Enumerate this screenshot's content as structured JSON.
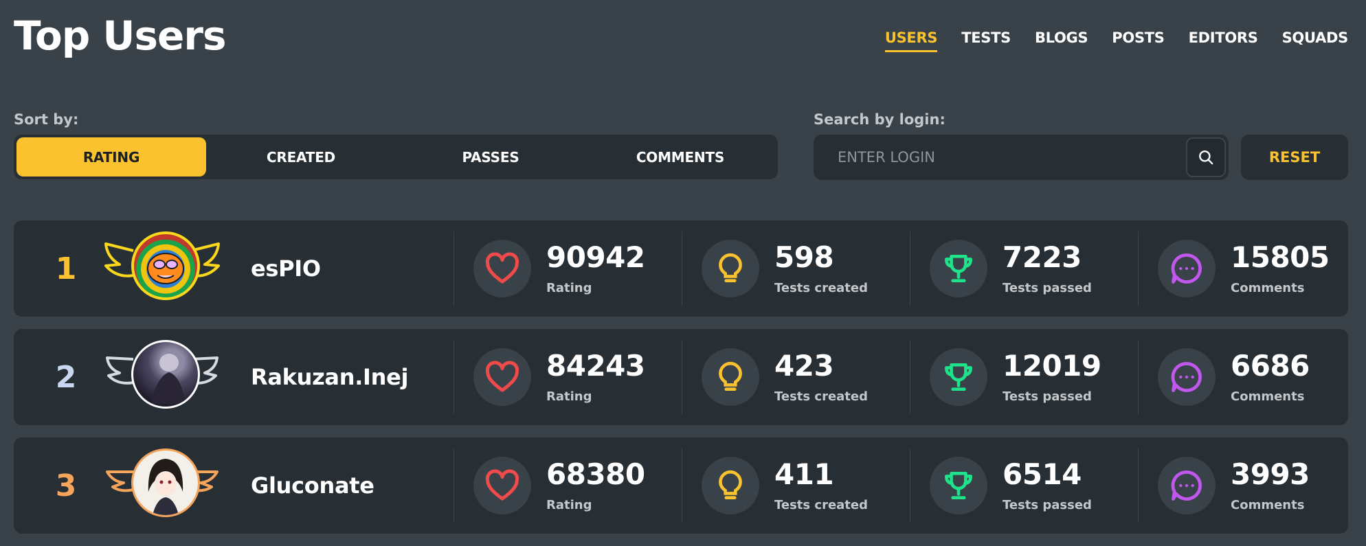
{
  "header": {
    "title": "Top Users",
    "nav": [
      {
        "label": "USERS",
        "active": true
      },
      {
        "label": "TESTS"
      },
      {
        "label": "BLOGS"
      },
      {
        "label": "POSTS"
      },
      {
        "label": "EDITORS"
      },
      {
        "label": "SQUADS"
      }
    ]
  },
  "sort": {
    "label": "Sort by:",
    "options": [
      {
        "label": "RATING",
        "active": true
      },
      {
        "label": "CREATED"
      },
      {
        "label": "PASSES"
      },
      {
        "label": "COMMENTS"
      }
    ]
  },
  "search": {
    "label": "Search by login:",
    "placeholder": "ENTER LOGIN",
    "value": "",
    "reset_label": "RESET"
  },
  "stat_labels": {
    "rating": "Rating",
    "created": "Tests created",
    "passed": "Tests passed",
    "comments": "Comments"
  },
  "users": [
    {
      "rank": "1",
      "name": "esPIO",
      "rating": "90942",
      "created": "598",
      "passed": "7223",
      "comments": "15805",
      "rank_color": "#f9c22e",
      "frame": "gold"
    },
    {
      "rank": "2",
      "name": "Rakuzan.Inej",
      "rating": "84243",
      "created": "423",
      "passed": "12019",
      "comments": "6686",
      "rank_color": "#c9d8f0",
      "frame": "silver"
    },
    {
      "rank": "3",
      "name": "Gluconate",
      "rating": "68380",
      "created": "411",
      "passed": "6514",
      "comments": "3993",
      "rank_color": "#f5a45c",
      "frame": "bronze"
    }
  ],
  "colors": {
    "accent": "#f9c22e",
    "background": "#394249",
    "panel": "#272f35",
    "rating_icon": "#f04a4a",
    "created_icon": "#f9c22e",
    "passed_icon": "#1fe38a",
    "comments_icon": "#c257ef"
  },
  "icons": {
    "rating": "heart-icon",
    "created": "lightbulb-icon",
    "passed": "trophy-icon",
    "comments": "comment-icon",
    "search": "search-icon"
  }
}
